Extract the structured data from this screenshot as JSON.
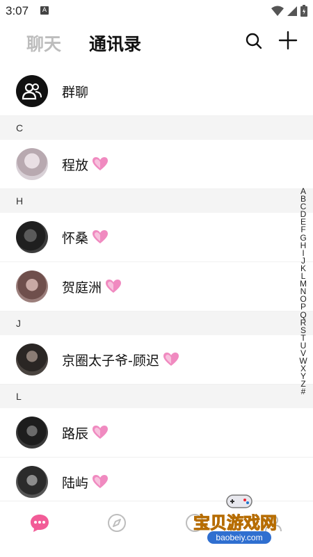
{
  "status": {
    "time": "3:07",
    "badge": "A"
  },
  "header": {
    "tab_chat": "聊天",
    "tab_contacts": "通讯录"
  },
  "contacts": {
    "group": {
      "label": "群聊"
    },
    "sections": [
      {
        "letter": "C",
        "items": [
          {
            "name": "程放"
          }
        ]
      },
      {
        "letter": "H",
        "items": [
          {
            "name": "怀桑"
          },
          {
            "name": "贺庭洲"
          }
        ]
      },
      {
        "letter": "J",
        "items": [
          {
            "name": "京圈太子爷-顾迟"
          }
        ]
      },
      {
        "letter": "L",
        "items": [
          {
            "name": "路辰"
          },
          {
            "name": "陆屿"
          }
        ]
      }
    ]
  },
  "alphabet": [
    "A",
    "B",
    "C",
    "D",
    "E",
    "F",
    "G",
    "H",
    "I",
    "J",
    "K",
    "L",
    "M",
    "N",
    "O",
    "P",
    "Q",
    "R",
    "S",
    "T",
    "U",
    "V",
    "W",
    "X",
    "Y",
    "Z",
    "#"
  ],
  "watermark": {
    "title": "宝贝游戏网",
    "url": "baobeiy.com"
  },
  "colors": {
    "accent": "#f25c97",
    "heart": "#f08ac0",
    "section_bg": "#f4f4f4"
  }
}
